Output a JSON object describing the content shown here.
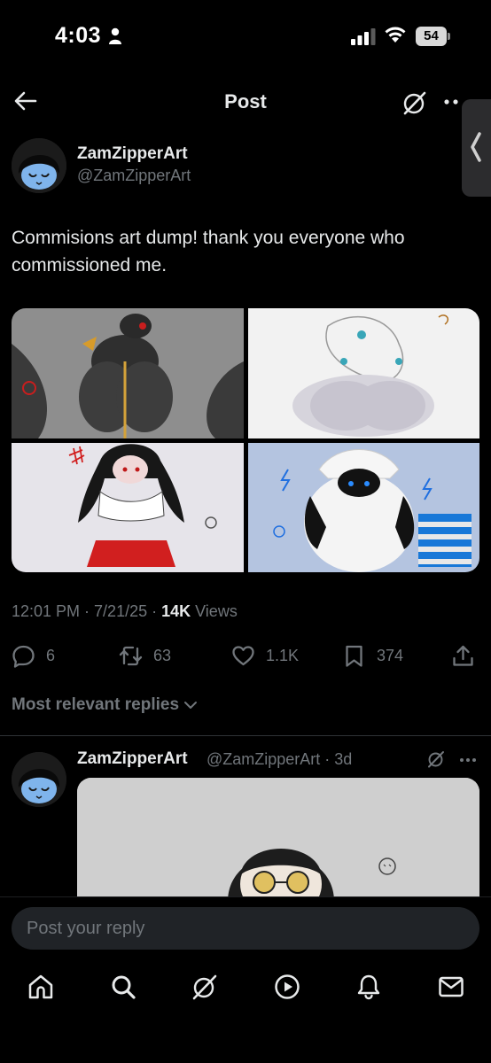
{
  "status_bar": {
    "time": "4:03",
    "battery": "54"
  },
  "header": {
    "title": "Post"
  },
  "post": {
    "author_name": "ZamZipperArt",
    "author_handle": "@ZamZipperArt",
    "text": "Commisions art dump! thank you everyone who commissioned me.",
    "meta_prefix": "12:01 PM · 7/21/25 · ",
    "views_count": "14K",
    "views_label": " Views",
    "media_count": 4
  },
  "actions": {
    "replies": "6",
    "reposts": "63",
    "likes": "1.1K",
    "bookmarks": "374"
  },
  "replies_filter": {
    "label": "Most relevant replies"
  },
  "reply": {
    "author_name": "ZamZipperArt",
    "handle_time": "@ZamZipperArt · 3d"
  },
  "composer": {
    "placeholder": "Post your reply"
  },
  "bottom_nav": {
    "items": [
      "home-icon",
      "search-icon",
      "grok-icon",
      "video-icon",
      "notifications-icon",
      "messages-icon"
    ]
  },
  "colors": {
    "background": "#000000",
    "text_primary": "#e7e9ea",
    "text_secondary": "#71767b",
    "divider": "#2f3336",
    "input_bg": "#202327"
  }
}
